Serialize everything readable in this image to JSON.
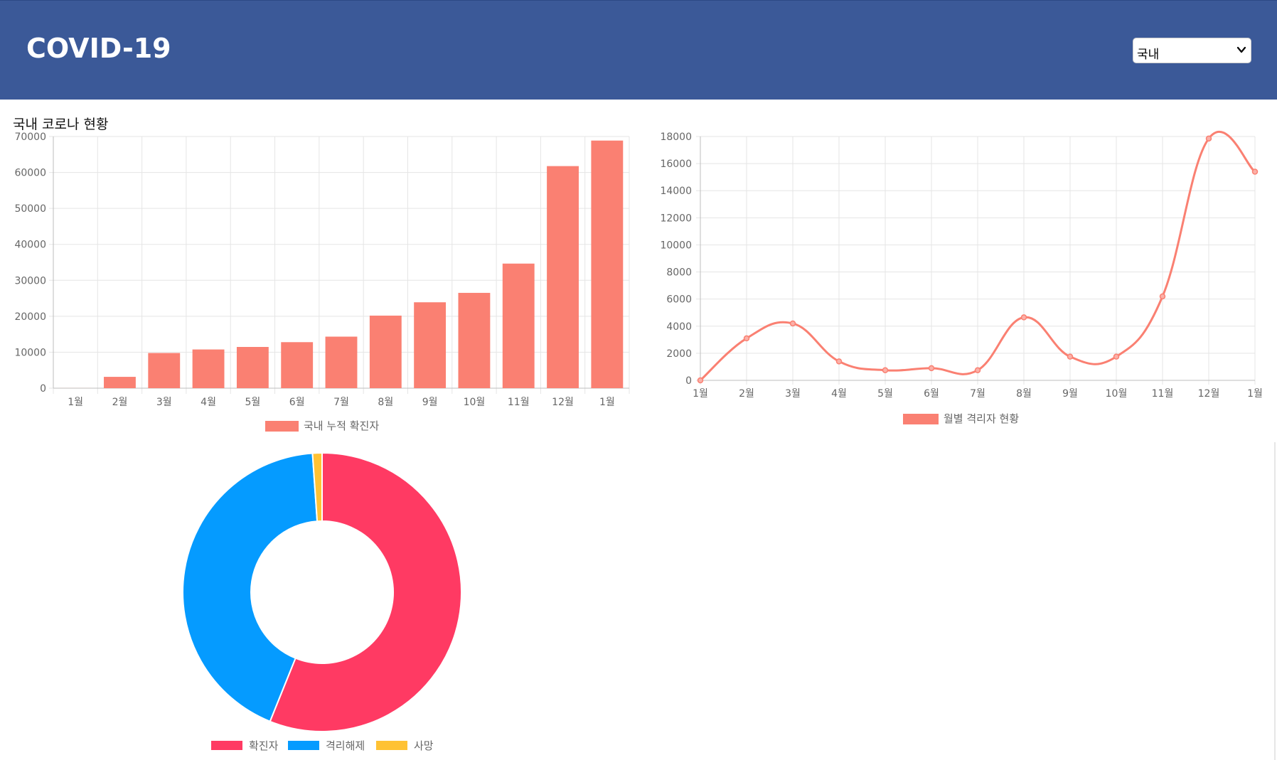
{
  "app": {
    "title": "COVID-19"
  },
  "region_select": {
    "value": "국내",
    "icon": "chevron-down-icon"
  },
  "section": {
    "title": "국내 코로나 현황"
  },
  "colors": {
    "header": "#3b5998",
    "bar": "#fa8072",
    "confirmed": "#ff3a63",
    "released": "#059bff",
    "deaths": "#ffc234"
  },
  "chart_data": [
    {
      "type": "bar",
      "categories": [
        "1월",
        "2월",
        "3월",
        "4월",
        "5월",
        "6월",
        "7월",
        "8월",
        "9월",
        "10월",
        "11월",
        "12월",
        "1월"
      ],
      "series": [
        {
          "name": "국내 누적 확진자",
          "values": [
            11,
            3150,
            9786,
            10765,
            11468,
            12800,
            14336,
            20182,
            23889,
            26511,
            34652,
            61769,
            68869
          ]
        }
      ],
      "ylim": [
        0,
        70000
      ],
      "yticks": [
        0,
        10000,
        20000,
        30000,
        40000,
        50000,
        60000,
        70000
      ],
      "legend": "bottom",
      "grid": true
    },
    {
      "type": "line",
      "categories": [
        "1월",
        "2월",
        "3월",
        "4월",
        "5월",
        "6월",
        "7월",
        "8월",
        "9월",
        "10월",
        "11월",
        "12월",
        "1월"
      ],
      "series": [
        {
          "name": "월별 격리자 현황",
          "values": [
            0,
            3100,
            4200,
            1400,
            750,
            900,
            750,
            4650,
            1750,
            1750,
            6200,
            17850,
            15400
          ]
        }
      ],
      "ylim": [
        0,
        18000
      ],
      "yticks": [
        0,
        2000,
        4000,
        6000,
        8000,
        10000,
        12000,
        14000,
        16000,
        18000
      ],
      "legend": "bottom",
      "grid": true
    },
    {
      "type": "pie",
      "categories": [
        "확진자",
        "격리해제",
        "사망"
      ],
      "values": [
        56.1,
        42.8,
        1.1
      ],
      "legend": "bottom"
    }
  ]
}
